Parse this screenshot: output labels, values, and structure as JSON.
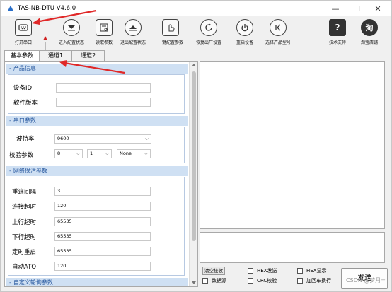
{
  "window": {
    "title": "TAS-NB-DTU V4.6.0"
  },
  "toolbar": {
    "items": [
      {
        "label": "打开串口",
        "icon": "serial-port-icon"
      },
      {
        "label": "进入配置状态",
        "icon": "enter-config-icon"
      },
      {
        "label": "读取参数",
        "icon": "read-params-icon"
      },
      {
        "label": "退出配置状态",
        "icon": "exit-config-icon"
      },
      {
        "label": "一键配置参数",
        "icon": "one-click-config-icon"
      },
      {
        "label": "恢复出厂设置",
        "icon": "factory-reset-icon"
      },
      {
        "label": "重启设备",
        "icon": "power-icon"
      },
      {
        "label": "选择产品型号",
        "icon": "select-product-icon"
      },
      {
        "label": "技术支持",
        "icon": "help-icon",
        "glyph": "?"
      },
      {
        "label": "淘宝店铺",
        "icon": "taobao-icon",
        "glyph": "淘"
      }
    ]
  },
  "tabs": [
    "基本参数",
    "通道1",
    "通道2"
  ],
  "sections": {
    "product": {
      "title": "产品信息",
      "fields": [
        {
          "label": "设备ID",
          "value": ""
        },
        {
          "label": "软件版本",
          "value": ""
        }
      ]
    },
    "serial": {
      "title": "串口参数",
      "baud_label": "波特率",
      "baud_value": "9600",
      "check_label": "校验参数",
      "data_bits": "8",
      "stop_bits": "1",
      "parity": "None"
    },
    "network": {
      "title": "网络保活参数",
      "fields": [
        {
          "label": "重连间隔",
          "value": "3"
        },
        {
          "label": "连接超时",
          "value": "120"
        },
        {
          "label": "上行超时",
          "value": "65535"
        },
        {
          "label": "下行超时",
          "value": "65535"
        },
        {
          "label": "定时重启",
          "value": "65535"
        },
        {
          "label": "自动ATO",
          "value": "120"
        }
      ]
    },
    "custom": {
      "title": "自定义轮询参数"
    }
  },
  "bottom": {
    "clear_recv": "清空接收",
    "data_source": "数据源",
    "hex_send": "HEX发送",
    "crc_check": "CRC校验",
    "hex_show": "HEX显示",
    "add_newline": "加回车换行",
    "send": "发送"
  },
  "watermark": "CSDN @梦月="
}
